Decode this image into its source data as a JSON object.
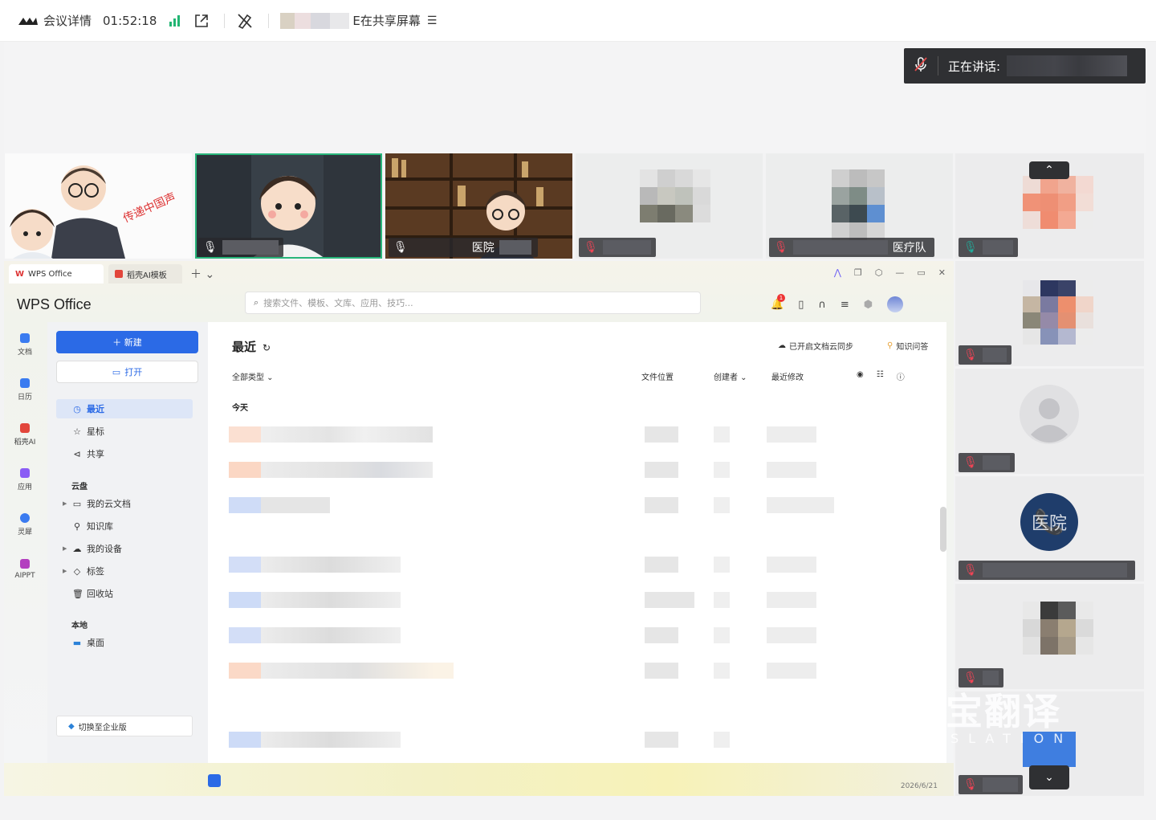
{
  "topbar": {
    "meeting_details": "会议详情",
    "timer": "01:52:18",
    "sharing_suffix": "E在共享屏幕"
  },
  "speaking": {
    "label": "正在讲话:"
  },
  "tiles": {
    "poster_text": "传递中国声",
    "tile3_name": "医院",
    "tile5_name": "医疗队",
    "phone_tile_name": "医院"
  },
  "wps": {
    "tab_wps": "WPS Office",
    "tab_template": "稻壳AI模板",
    "brand": "WPS Office",
    "search_placeholder": "搜索文件、模板、文库、应用、技巧...",
    "notification_count": "1",
    "rail": [
      {
        "label": "文档",
        "color": "#3a7bf0"
      },
      {
        "label": "日历",
        "color": "#3a7bf0"
      },
      {
        "label": "稻壳AI",
        "color": "#e2463b"
      },
      {
        "label": "应用",
        "color": "#8a5cf5"
      },
      {
        "label": "灵犀",
        "color": "#3a7bf0"
      },
      {
        "label": "AIPPT",
        "color": "#b33fbf"
      }
    ],
    "new_button": "＋ 新建",
    "open_button": "打开",
    "nav": {
      "recent": "最近",
      "star": "星标",
      "share": "共享",
      "cloud_head": "云盘",
      "my_cloud": "我的云文档",
      "knowledge": "知识库",
      "my_device": "我的设备",
      "tags": "标签",
      "trash": "回收站",
      "local_head": "本地",
      "desktop": "桌面",
      "switch_enterprise": "切换至企业版"
    },
    "main": {
      "title": "最近",
      "cloud_sync": "已开启文档云同步",
      "knowledge_qa": "知识问答",
      "filter_all": "全部类型",
      "col_location": "文件位置",
      "col_creator": "创建者",
      "col_modified": "最近修改",
      "today": "今天"
    },
    "taskbar_date": "2026/6/21"
  },
  "watermark": {
    "main": "得宝翻译",
    "sub": "NSLATION"
  }
}
